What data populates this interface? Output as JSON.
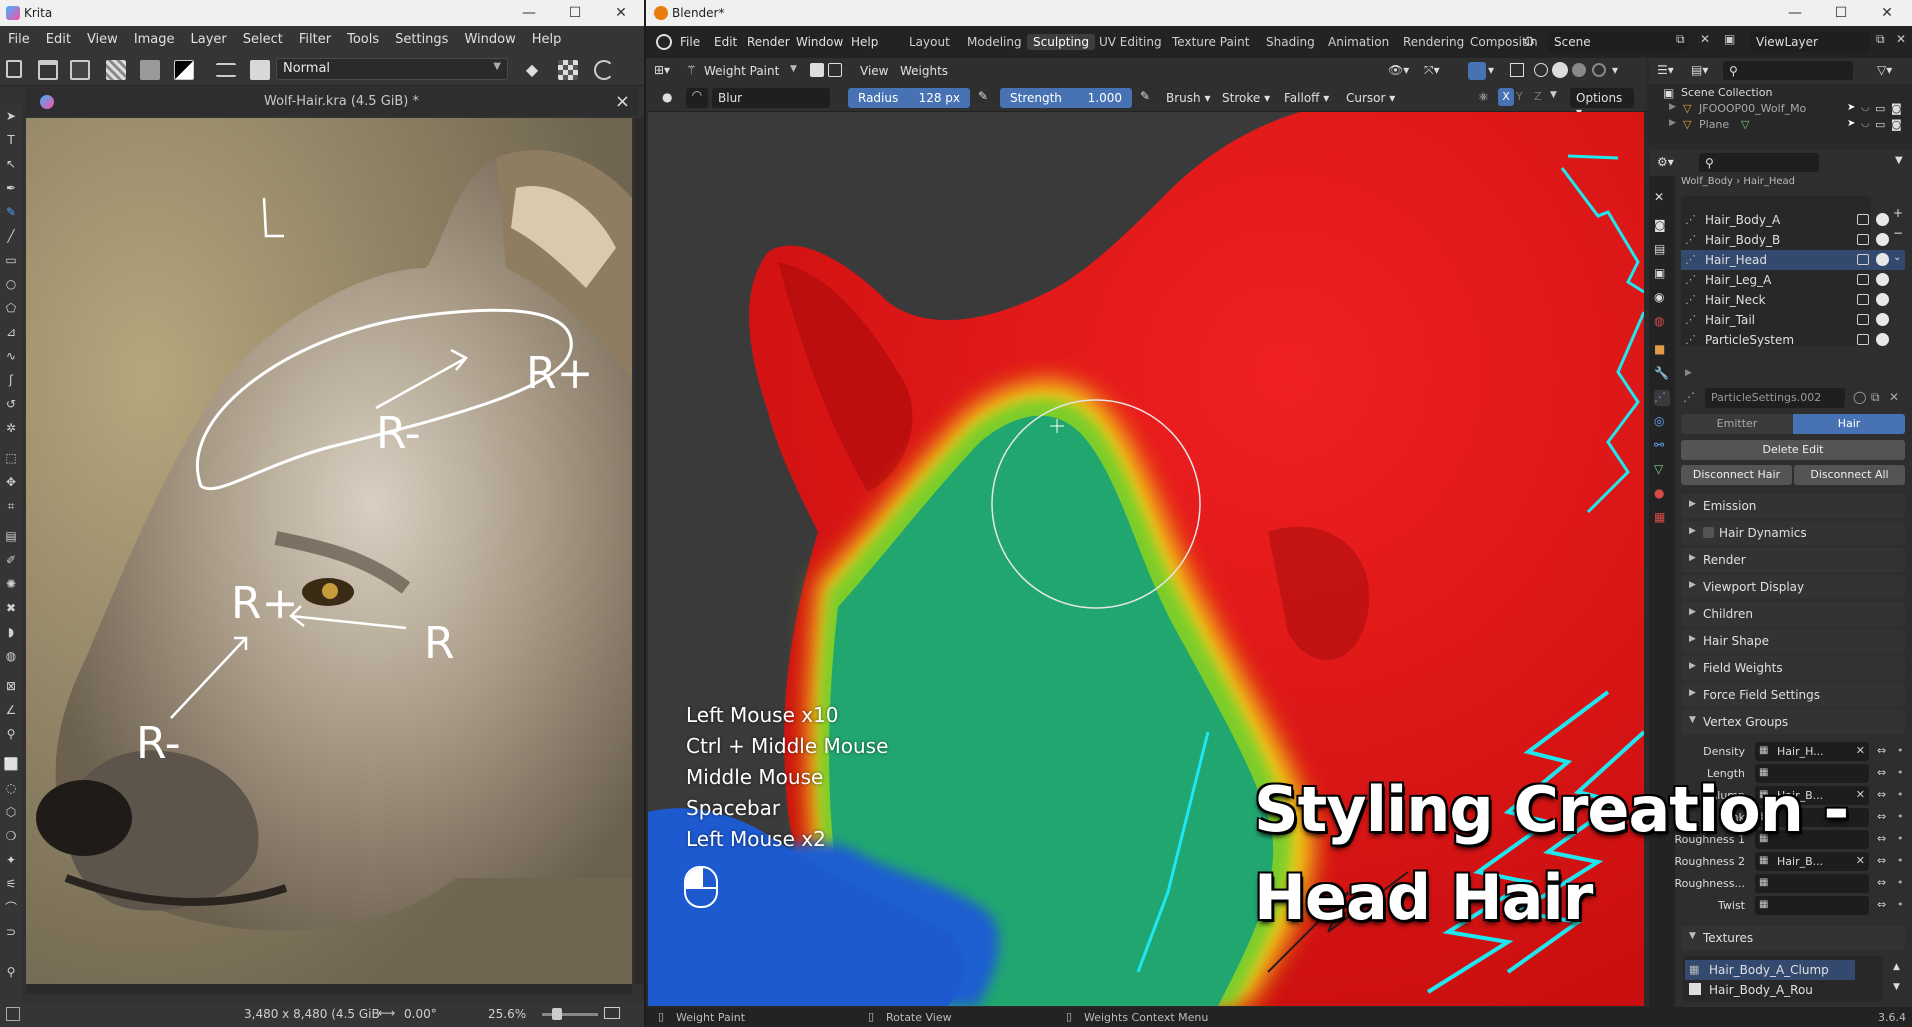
{
  "krita": {
    "title": "Krita",
    "menu": [
      "File",
      "Edit",
      "View",
      "Image",
      "Layer",
      "Select",
      "Filter",
      "Tools",
      "Settings",
      "Window",
      "Help"
    ],
    "blend_mode": "Normal",
    "doc_tab": "Wolf-Hair.kra (4.5 GiB) *",
    "status": {
      "size": "3,480 x 8,480 (4.5 GiB",
      "rotation": "0.00°",
      "zoom": "25.6%"
    },
    "annotations": [
      "R+",
      "R-",
      "R+",
      "R",
      "R-"
    ]
  },
  "blender": {
    "title": "Blender*",
    "menu": [
      "File",
      "Edit",
      "Render",
      "Window",
      "Help"
    ],
    "workspaces": [
      "Layout",
      "Modeling",
      "Sculpting",
      "UV Editing",
      "Texture Paint",
      "Shading",
      "Animation",
      "Rendering",
      "Compositin"
    ],
    "active_workspace": "Sculpting",
    "scene": "Scene",
    "view_layer": "ViewLayer",
    "mode": "Weight Paint",
    "header_menus": [
      "View",
      "Weights"
    ],
    "brush_name": "Blur",
    "radius_label": "Radius",
    "radius_value": "128 px",
    "strength_label": "Strength",
    "strength_value": "1.000",
    "tool_menus": [
      "Brush",
      "Stroke",
      "Falloff",
      "Cursor"
    ],
    "axes": [
      "X",
      "Y",
      "Z"
    ],
    "options_label": "Options",
    "outliner": {
      "collection": "Scene Collection",
      "items": [
        "JFOOOP00_Wolf_Mo",
        "Plane"
      ]
    },
    "breadcrumb": [
      "Wolf_Body",
      "Hair_Head"
    ],
    "particle_systems": [
      "Hair_Body_A",
      "Hair_Body_B",
      "Hair_Head",
      "Hair_Leg_A",
      "Hair_Neck",
      "Hair_Tail",
      "ParticleSystem"
    ],
    "selected_system": "Hair_Head",
    "particle_settings": "ParticleSettings.002",
    "type_tabs": [
      "Emitter",
      "Hair"
    ],
    "active_type": "Hair",
    "delete_edit": "Delete Edit",
    "disconnect_hair": "Disconnect Hair",
    "disconnect_all": "Disconnect All",
    "panels": [
      "Emission",
      "Hair Dynamics",
      "Render",
      "Viewport Display",
      "Children",
      "Hair Shape",
      "Field Weights",
      "Force Field Settings",
      "Vertex Groups"
    ],
    "vertex_groups": [
      {
        "label": "Density",
        "value": "Hair_H...",
        "clear": true
      },
      {
        "label": "Length",
        "value": "",
        "clear": false
      },
      {
        "label": "Clump",
        "value": "Hair_B...",
        "clear": true
      },
      {
        "label": "Kink",
        "value": "",
        "clear": false
      },
      {
        "label": "Roughness 1",
        "value": "",
        "clear": false
      },
      {
        "label": "Roughness 2",
        "value": "Hair_B...",
        "clear": true
      },
      {
        "label": "Roughness...",
        "value": "",
        "clear": false
      },
      {
        "label": "Twist",
        "value": "",
        "clear": false
      }
    ],
    "textures_panel": "Textures",
    "textures": [
      "Hair_Body_A_Clump",
      "Hair_Body_A_Rou"
    ],
    "status": [
      "Weight Paint",
      "Rotate View",
      "Weights Context Menu"
    ],
    "version": "3.6.4"
  },
  "overlay": {
    "keys": [
      "Left Mouse x10",
      "Ctrl + Middle Mouse",
      "Middle Mouse",
      "Spacebar",
      "Left Mouse x2"
    ],
    "title_line1": "Styling Creation -",
    "title_line2": "Head Hair"
  },
  "colors": {
    "accent_blue": "#4772b3",
    "weight_red": "#e81c1c",
    "weight_green": "#21a86f",
    "weight_blue": "#1d5fd0",
    "hair_cyan": "#1fe7f2"
  }
}
